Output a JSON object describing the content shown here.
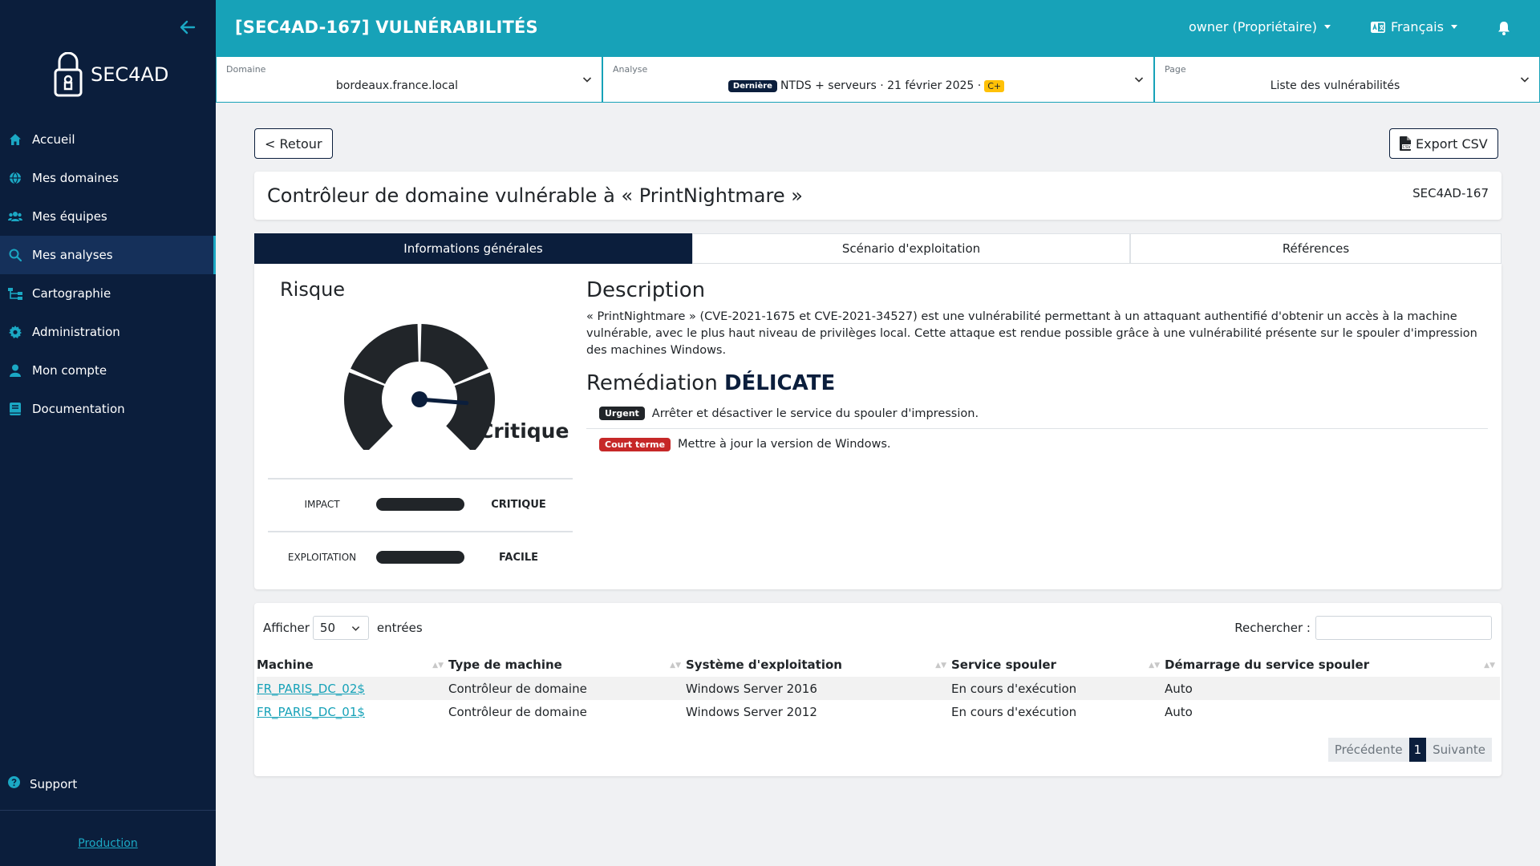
{
  "sidebar": {
    "logo_text": "SEC4AD",
    "items": [
      {
        "label": "Accueil",
        "icon": "home-icon"
      },
      {
        "label": "Mes domaines",
        "icon": "globe-icon"
      },
      {
        "label": "Mes équipes",
        "icon": "users-icon"
      },
      {
        "label": "Mes analyses",
        "icon": "search-icon",
        "active": true
      },
      {
        "label": "Cartographie",
        "icon": "sitemap-icon"
      },
      {
        "label": "Administration",
        "icon": "gear-icon"
      },
      {
        "label": "Mon compte",
        "icon": "user-icon"
      },
      {
        "label": "Documentation",
        "icon": "book-icon"
      }
    ],
    "support_label": "Support",
    "environment_link": "Production"
  },
  "header": {
    "title": "[SEC4AD-167] VULNÉRABILITÉS",
    "user_menu": "owner (Propriétaire)",
    "language": "Français"
  },
  "selectors": {
    "domain": {
      "label": "Domaine",
      "value": "bordeaux.france.local"
    },
    "analysis": {
      "label": "Analyse",
      "badge": "Dernière",
      "value": "NTDS + serveurs · 21 février 2025 ·",
      "grade": "C+"
    },
    "page": {
      "label": "Page",
      "value": "Liste des vulnérabilités"
    }
  },
  "actions": {
    "back": "< Retour",
    "export": "Export CSV"
  },
  "vulnerability": {
    "title": "Contrôleur de domaine vulnérable à « PrintNightmare »",
    "id": "SEC4AD-167"
  },
  "tabs": [
    "Informations générales",
    "Scénario d'exploitation",
    "Références"
  ],
  "risk": {
    "title": "Risque",
    "level": "Critique",
    "gauge_fraction": 0.85,
    "metrics": [
      {
        "label": "IMPACT",
        "value": "CRITIQUE"
      },
      {
        "label": "EXPLOITATION",
        "value": "FACILE"
      }
    ]
  },
  "description": {
    "title": "Description",
    "text": "« PrintNightmare » (CVE-2021-1675 et CVE-2021-34527) est une vulnérabilité permettant à un attaquant authentifié d'obtenir un accès à la machine vulnérable, avec le plus haut niveau de privilèges local. Cette attaque est rendue possible grâce à une vulnérabilité présente sur le spouler d'impression des machines Windows."
  },
  "remediation": {
    "title": "Remédiation",
    "difficulty": "DÉLICATE",
    "steps": [
      {
        "badge": "Urgent",
        "text": "Arrêter et désactiver le service du spouler d'impression."
      },
      {
        "badge": "Court terme",
        "text": "Mettre à jour la version de Windows."
      }
    ]
  },
  "table": {
    "show_label": "Afficher",
    "page_size": "50",
    "entries_label": "entrées",
    "search_label": "Rechercher :",
    "columns": [
      "Machine",
      "Type de machine",
      "Système d'exploitation",
      "Service spouler",
      "Démarrage du service spouler"
    ],
    "rows": [
      [
        "FR_PARIS_DC_02$",
        "Contrôleur de domaine",
        "Windows Server 2016",
        "En cours d'exécution",
        "Auto"
      ],
      [
        "FR_PARIS_DC_01$",
        "Contrôleur de domaine",
        "Windows Server 2012",
        "En cours d'exécution",
        "Auto"
      ]
    ],
    "pager": {
      "prev": "Précédente",
      "current": "1",
      "next": "Suivante"
    }
  },
  "colors": {
    "accent": "#17a2b8",
    "navy": "#0b1e3c",
    "danger": "#c62828",
    "warning": "#ffc107"
  }
}
